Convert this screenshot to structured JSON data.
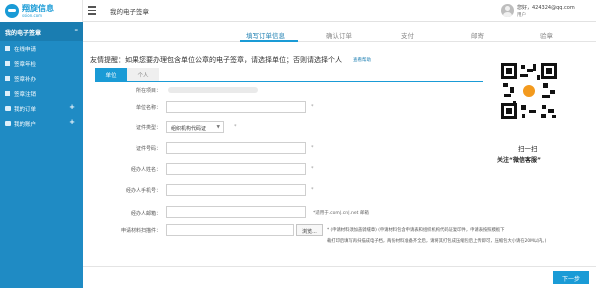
{
  "brand": {
    "name": "翔旋信息",
    "sub": "ssion.com"
  },
  "header": {
    "title": "我的电子签章",
    "user_greeting": "您好，424324@qq.com",
    "user_role": "用户"
  },
  "sidebar": {
    "section": "我的电子签章",
    "items": [
      {
        "label": "在线申请"
      },
      {
        "label": "签章年检"
      },
      {
        "label": "签章补办"
      },
      {
        "label": "签章注销"
      },
      {
        "label": "我的订单",
        "expandable": true
      },
      {
        "label": "我的账户",
        "expandable": true
      }
    ]
  },
  "steps": [
    "填写订单信息",
    "确认订单",
    "支付",
    "邮寄",
    "验章"
  ],
  "reminder": {
    "text": "友情提醒：如果您要办理包含单位公章的电子签章，请选择单位；否则请选择个人",
    "help": "查看帮助"
  },
  "tabs": {
    "unit": "单位",
    "person": "个人"
  },
  "form": {
    "region_label": "所在项目：",
    "unit_name_label": "单位名称：",
    "cert_type_label": "证件类型：",
    "cert_type_value": "组织机构代码证",
    "cert_number_label": "证件号码：",
    "agent_name_label": "经办人姓名：",
    "agent_phone_label": "经办人手机号：",
    "agent_email_label": "经办人邮箱：",
    "email_hint": "*适用于.com|.cn|.net 邮箱",
    "scan_label": "申请材料扫描件：",
    "browse": "浏览...",
    "required_mark": "*",
    "note_line1": "* (申请材料须加盖骑缝章) (申请材料包含申请表和组织机构代码证复印件，申请表按照模板下",
    "note_line2": "载打印后填写再扫描成电子档，两份材料准备齐全后，请将其打包成压缩包后上传即可，压缩包大小请在20M以内。)"
  },
  "qr": {
    "line1": "扫一扫",
    "line2": "关注“微信客服”"
  },
  "actions": {
    "next": "下一步"
  }
}
